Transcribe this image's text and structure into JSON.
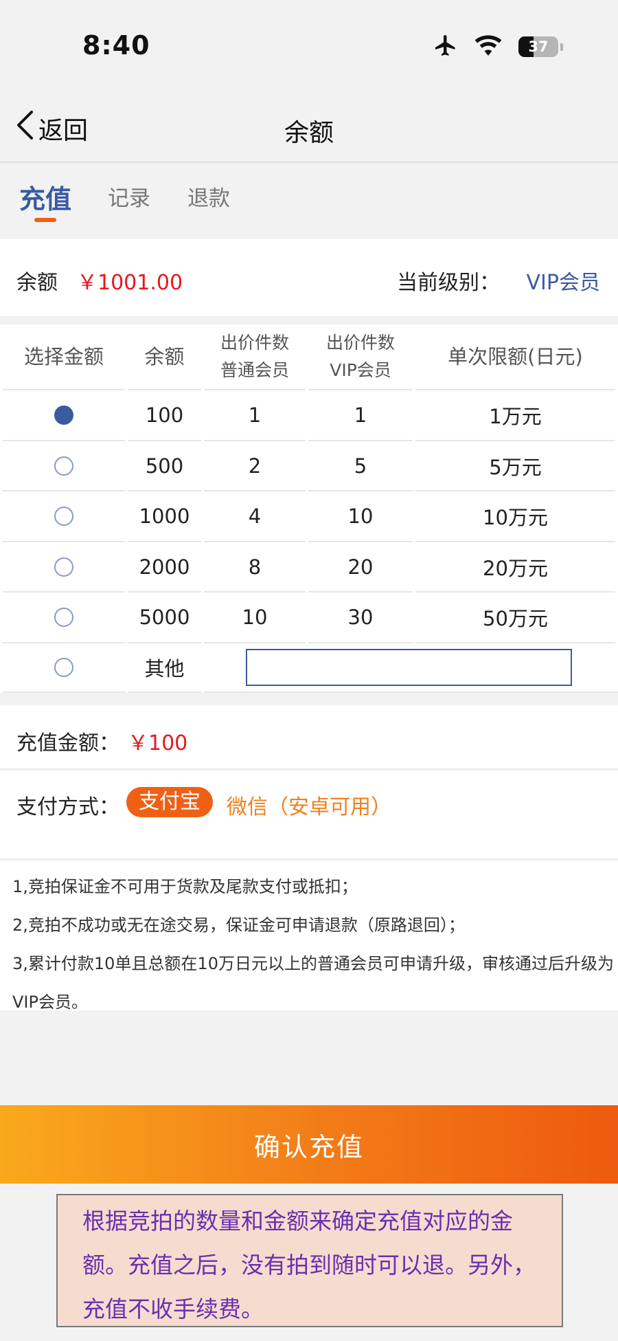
{
  "status_bar": {
    "time": "8:40",
    "battery_level": "37",
    "icons": [
      "airplane-icon",
      "wifi-icon",
      "battery-icon"
    ]
  },
  "nav": {
    "back_label": "返回",
    "title": "余额"
  },
  "tabs": [
    {
      "label": "充值",
      "active": true
    },
    {
      "label": "记录",
      "active": false
    },
    {
      "label": "退款",
      "active": false
    }
  ],
  "balance": {
    "label": "余额",
    "value": "￥1001.00",
    "level_label": "当前级别：",
    "level_value": "VIP会员"
  },
  "table": {
    "headers": {
      "select": "选择金额",
      "balance": "余额",
      "normal_line1": "出价件数",
      "normal_line2": "普通会员",
      "vip_line1": "出价件数",
      "vip_line2": "VIP会员",
      "limit": "单次限额(日元)"
    },
    "rows": [
      {
        "amount": "100",
        "normal": "1",
        "vip": "1",
        "limit": "1万元",
        "selected": true
      },
      {
        "amount": "500",
        "normal": "2",
        "vip": "5",
        "limit": "5万元",
        "selected": false
      },
      {
        "amount": "1000",
        "normal": "4",
        "vip": "10",
        "limit": "10万元",
        "selected": false
      },
      {
        "amount": "2000",
        "normal": "8",
        "vip": "20",
        "limit": "20万元",
        "selected": false
      },
      {
        "amount": "5000",
        "normal": "10",
        "vip": "30",
        "limit": "50万元",
        "selected": false
      }
    ],
    "other_label": "其他",
    "other_value": ""
  },
  "recharge": {
    "label": "充值金额：",
    "value": "￥100"
  },
  "payment": {
    "label": "支付方式：",
    "alipay": "支付宝",
    "wechat": "微信（安卓可用）"
  },
  "notes": [
    "1,竞拍保证金不可用于货款及尾款支付或抵扣；",
    "2,竞拍不成功或无在途交易，保证金可申请退款（原路退回）；",
    "3,累计付款10单且总额在10万日元以上的普通会员可申请升级，审核通过后升级为VIP会员。"
  ],
  "confirm_label": "确认充值",
  "annotation": "根据竞拍的数量和金额来确定充值对应的金额。充值之后，没有拍到随时可以退。另外，充值不收手续费。",
  "colors": {
    "primary_blue": "#3a5ba0",
    "accent_orange": "#f06014",
    "price_red": "#e8181d",
    "annotation_text": "#6a2fb0",
    "annotation_bg": "#f6dccf"
  }
}
